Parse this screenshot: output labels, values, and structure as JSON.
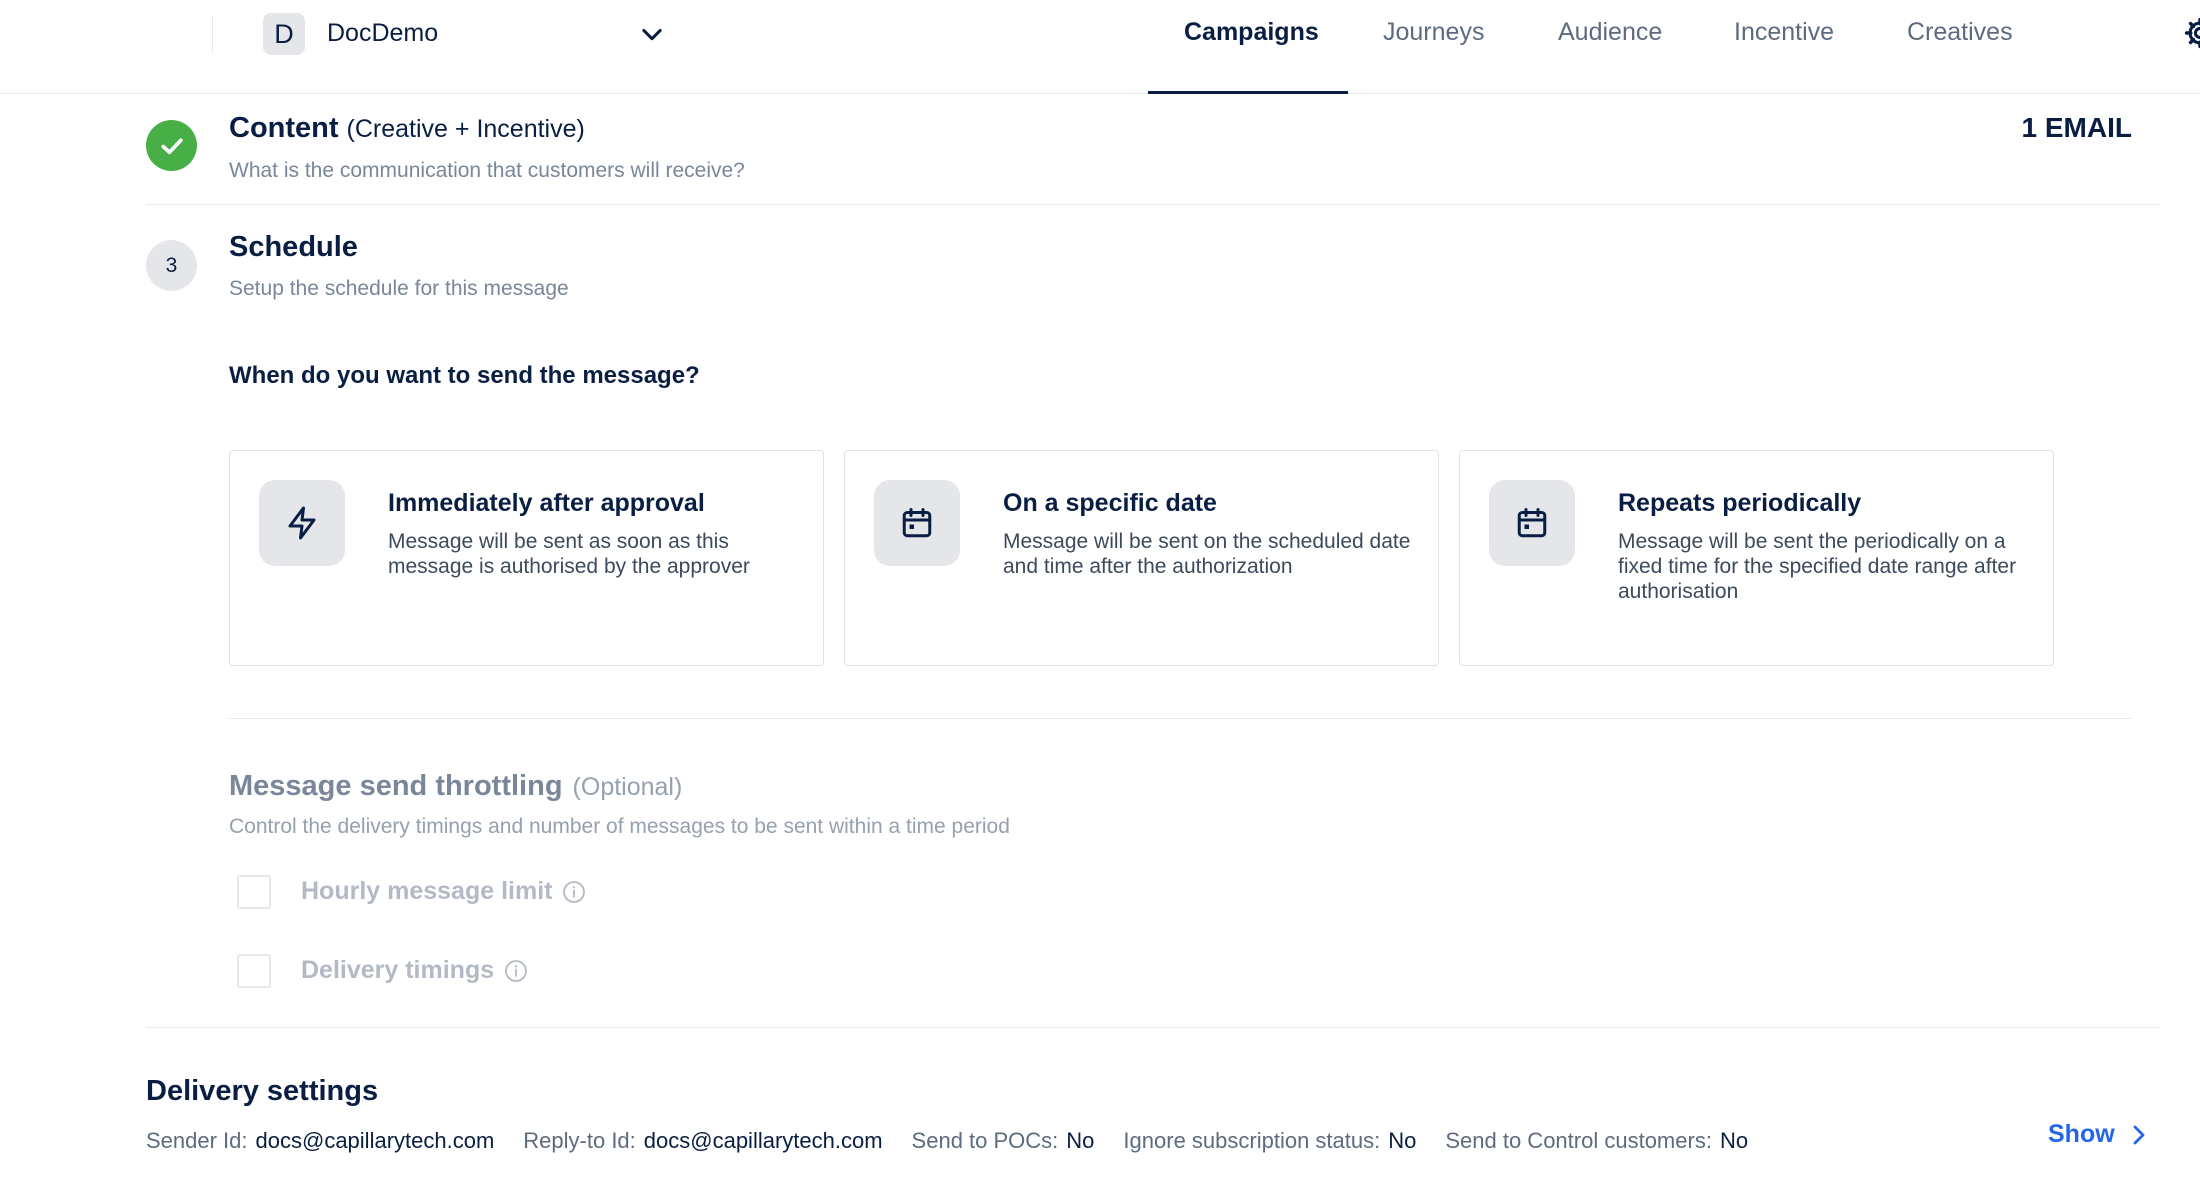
{
  "header": {
    "org_initial": "D",
    "org_name": "DocDemo",
    "tabs": [
      {
        "label": "Campaigns",
        "active": true
      },
      {
        "label": "Journeys",
        "active": false
      },
      {
        "label": "Audience",
        "active": false
      },
      {
        "label": "Incentive",
        "active": false
      },
      {
        "label": "Creatives",
        "active": false
      }
    ]
  },
  "content_step": {
    "title": "Content",
    "title_extra": "(Creative + Incentive)",
    "subtitle": "What is the communication that customers will receive?",
    "summary": "1 EMAIL",
    "status": "complete"
  },
  "schedule_step": {
    "number": "3",
    "title": "Schedule",
    "subtitle": "Setup the schedule for this message",
    "question": "When do you want to send the message?",
    "options": [
      {
        "icon": "lightning-icon",
        "title": "Immediately after approval",
        "description": "Message will be sent as soon as this message is authorised by the approver"
      },
      {
        "icon": "calendar-icon",
        "title": "On a specific date",
        "description": "Message will be sent on the scheduled date and time after the authorization"
      },
      {
        "icon": "calendar-icon",
        "title": "Repeats periodically",
        "description": "Message will be sent the periodically on a fixed time for the specified date range after authorisation"
      }
    ]
  },
  "throttling": {
    "title": "Message send throttling",
    "optional": "(Optional)",
    "subtitle": "Control the delivery timings and number of messages to be sent within a time period",
    "checkboxes": [
      {
        "label": "Hourly message limit",
        "checked": false
      },
      {
        "label": "Delivery timings",
        "checked": false
      }
    ]
  },
  "delivery": {
    "title": "Delivery settings",
    "fields": [
      {
        "label": "Sender Id:",
        "value": "docs@capillarytech.com"
      },
      {
        "label": "Reply-to Id:",
        "value": "docs@capillarytech.com"
      },
      {
        "label": "Send to POCs:",
        "value": "No"
      },
      {
        "label": "Ignore subscription status:",
        "value": "No"
      },
      {
        "label": "Send to Control customers:",
        "value": "No"
      }
    ],
    "show_label": "Show"
  },
  "colors": {
    "success": "#47af46",
    "link": "#2466ea",
    "text": "#091e42"
  }
}
